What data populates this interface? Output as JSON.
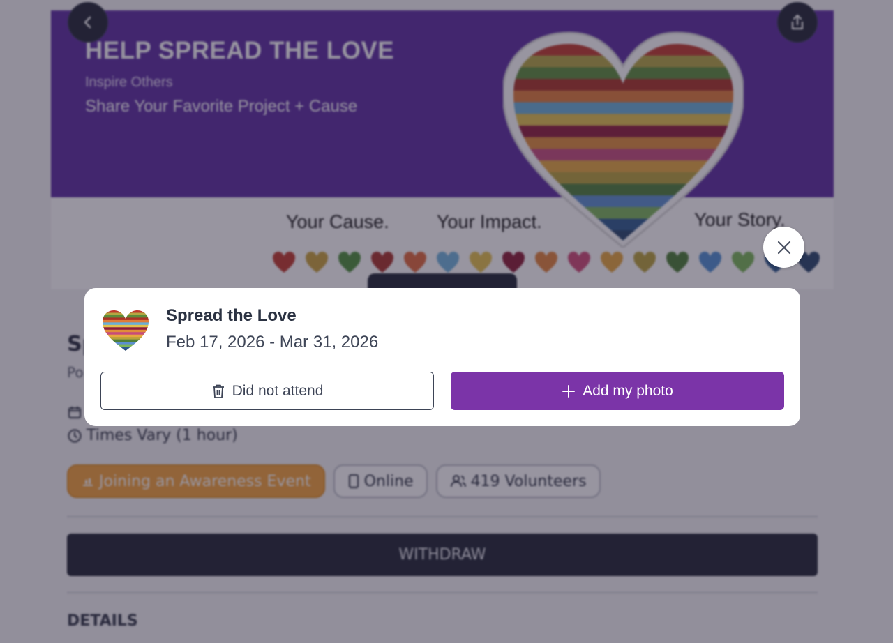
{
  "banner": {
    "title": "HELP SPREAD THE LOVE",
    "subtitle": "Inspire Others",
    "tagline": "Share Your Favorite Project + Cause",
    "phrases": [
      "Your Cause.",
      "Your Impact.",
      "Your Story."
    ],
    "heart_stripe_colors": [
      "#c0392b",
      "#b5a642",
      "#5d8c3a",
      "#a93226",
      "#e07b39",
      "#6aaed6",
      "#e2c14d",
      "#8e1c3a",
      "#e08c3b",
      "#c64b7c",
      "#e6a83f",
      "#b8a23a",
      "#4e7f3a",
      "#5b8fd0",
      "#7cb55a",
      "#2c5a8f",
      "#27456b"
    ],
    "mini_heart_colors": [
      "#c0392b",
      "#c9a23a",
      "#4d8f3a",
      "#a8322a",
      "#e0683a",
      "#6fb2dc",
      "#e4c04a",
      "#8a1b34",
      "#e3833a",
      "#cf4a76",
      "#e6a53c",
      "#b9a23b",
      "#4a7d34",
      "#4f8fd3",
      "#79b656",
      "#2c5a8f",
      "#27456b"
    ]
  },
  "page": {
    "back_icon": "chevron-left-icon",
    "share_icon": "share-icon",
    "title_partial": "Sp",
    "subtitle_partial": "Po",
    "time_text": "Times Vary (1 hour)",
    "chips": [
      {
        "icon": "hands-icon",
        "label": "Joining an Awareness Event"
      },
      {
        "icon": "phone-icon",
        "label": "Online"
      },
      {
        "icon": "users-icon",
        "label": "419 Volunteers"
      }
    ],
    "withdraw_label": "WITHDRAW",
    "details_label": "DETAILS"
  },
  "modal": {
    "title": "Spread the Love",
    "date_range": "Feb 17, 2026 - Mar 31, 2026",
    "did_not_attend_label": "Did not attend",
    "add_photo_label": "Add my photo",
    "colors": {
      "primary": "#7b34a8"
    }
  }
}
